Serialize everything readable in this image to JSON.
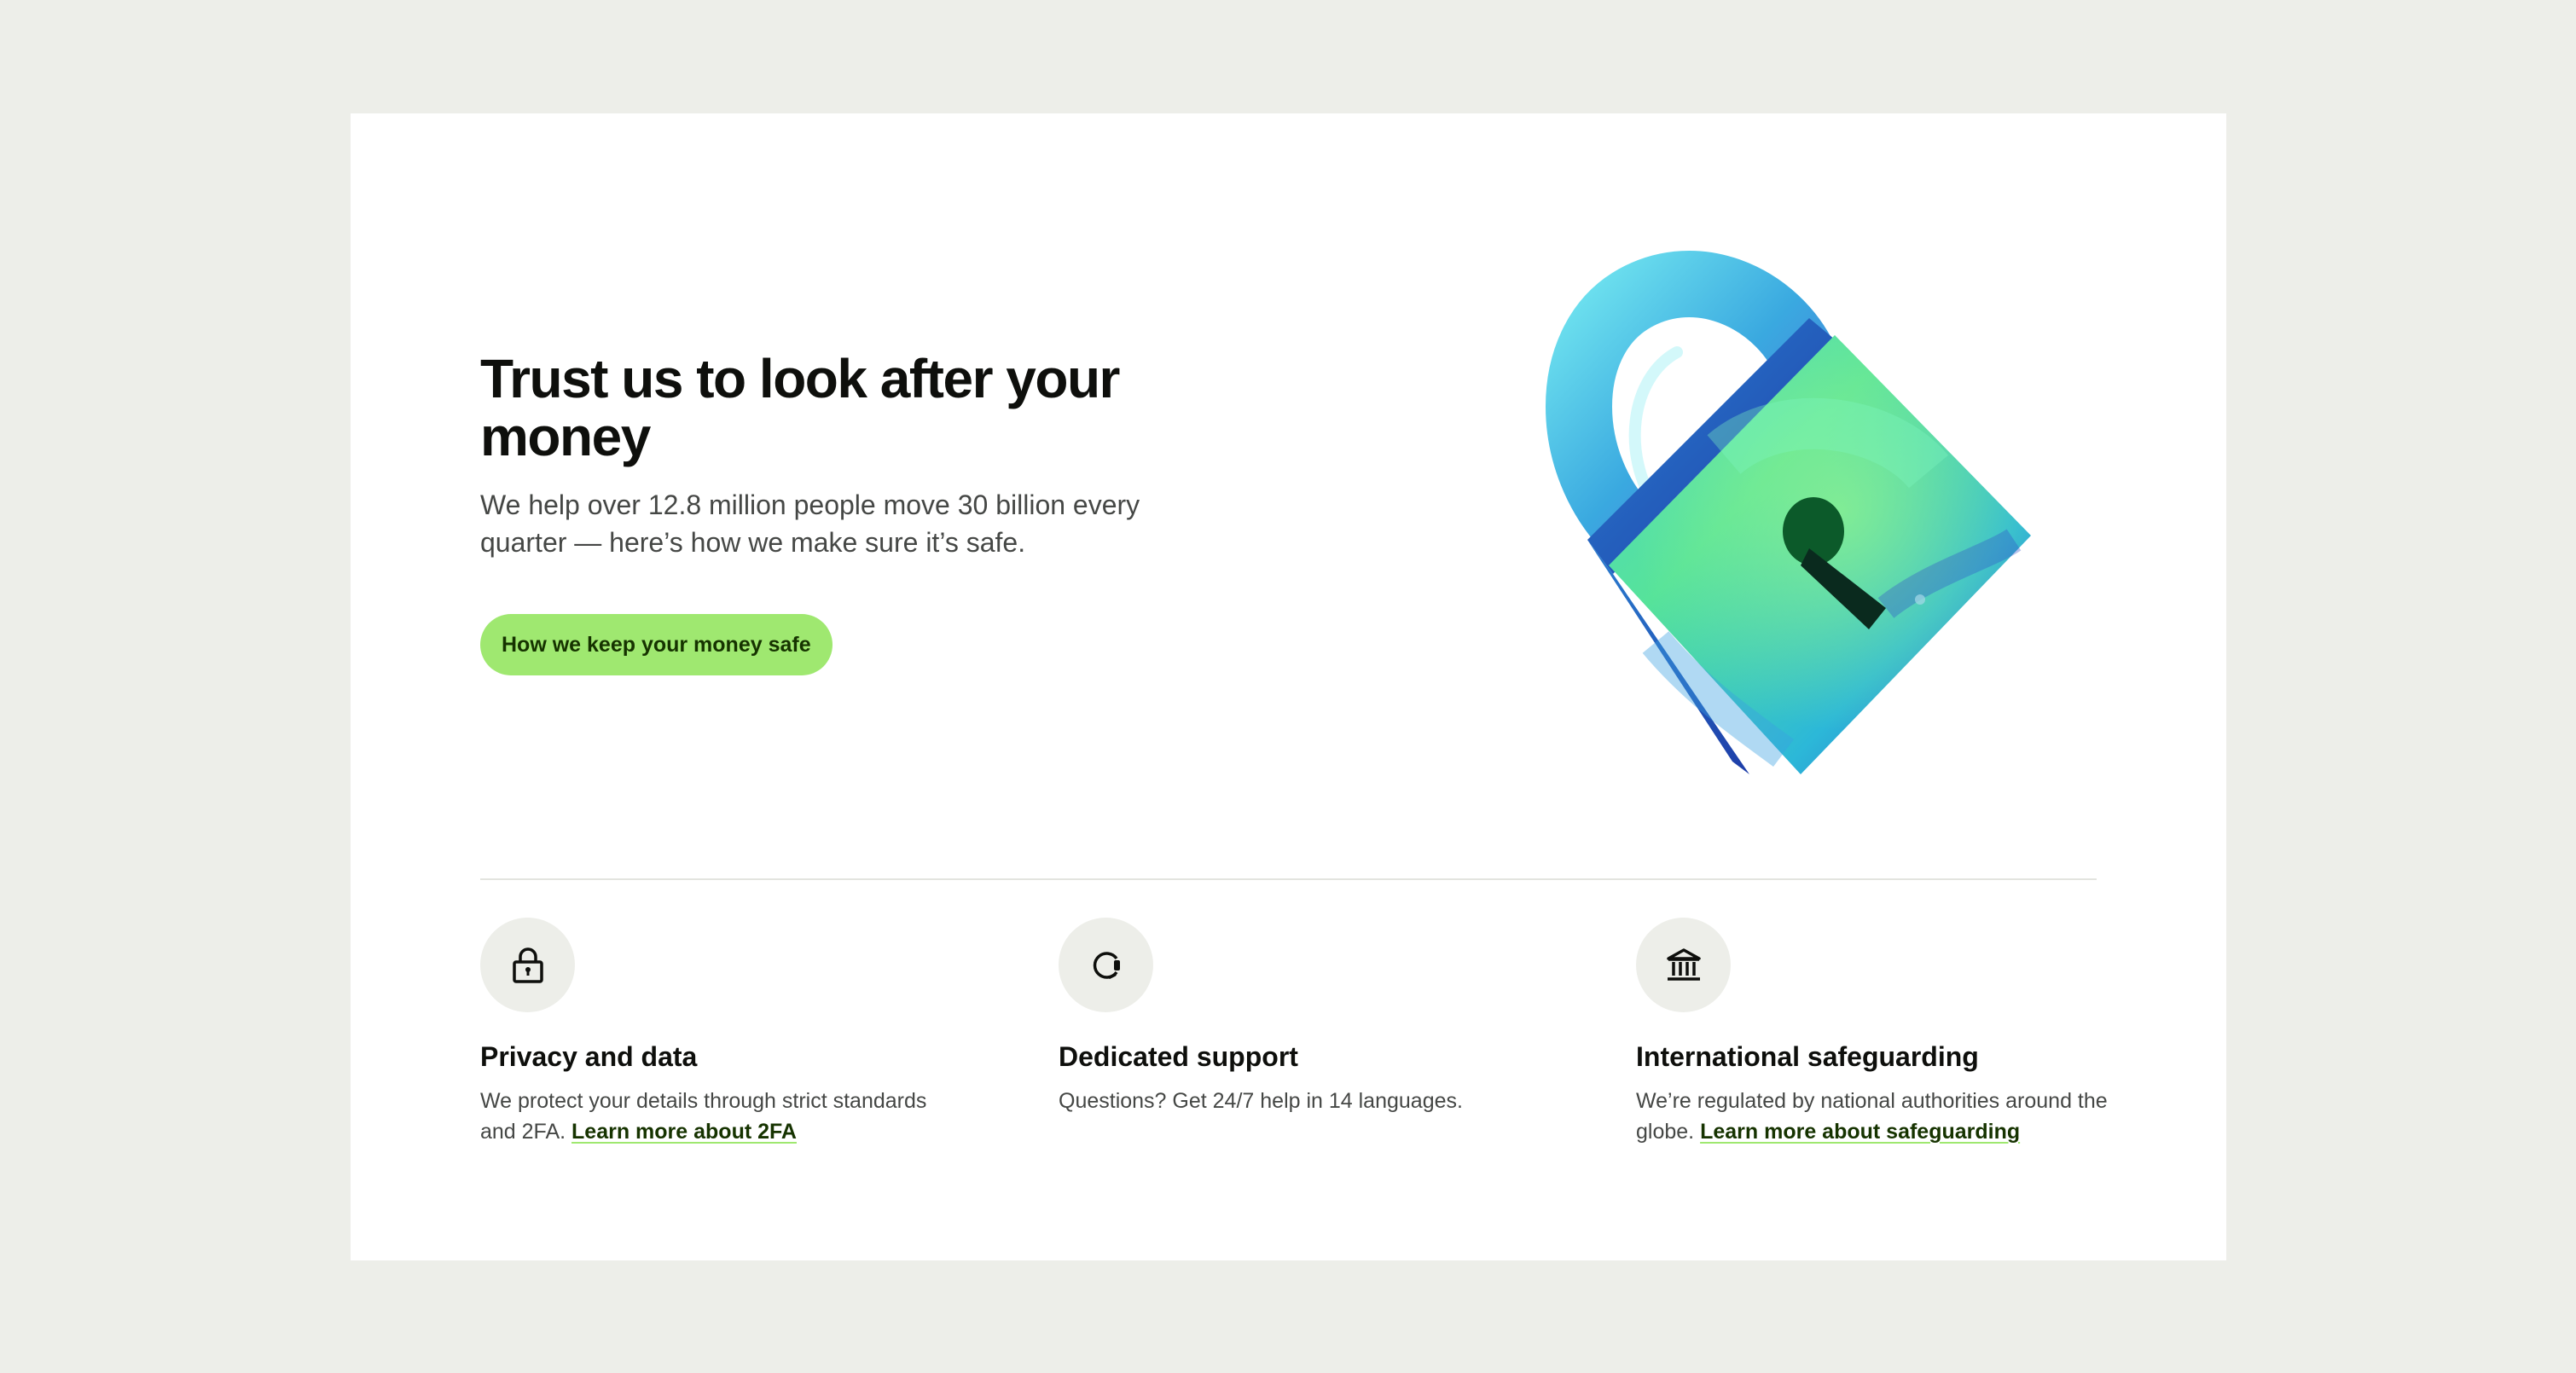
{
  "hero": {
    "title": "Trust us to look after your money",
    "subtitle": "We help over 12.8 million people move 30 billion every quarter — here’s how we make sure it’s safe.",
    "cta_label": "How we keep your money safe",
    "image_icon": "padlock-illustration"
  },
  "features": [
    {
      "icon": "lock-icon",
      "title": "Privacy and data",
      "text": "We protect your details through strict standards and 2FA.",
      "link": "Learn more about 2FA"
    },
    {
      "icon": "headset-icon",
      "title": "Dedicated support",
      "text": "Questions? Get 24/7 help in 14 languages.",
      "link": ""
    },
    {
      "icon": "bank-icon",
      "title": "International safeguarding",
      "text": "We’re regulated by national authorities around the globe.",
      "link": "Learn more about safeguarding"
    }
  ],
  "colors": {
    "background": "#edeee9",
    "card": "#ffffff",
    "accent": "#9fe870",
    "accent_text": "#163300",
    "text_primary": "#0e0f0c",
    "text_secondary": "#454745"
  }
}
